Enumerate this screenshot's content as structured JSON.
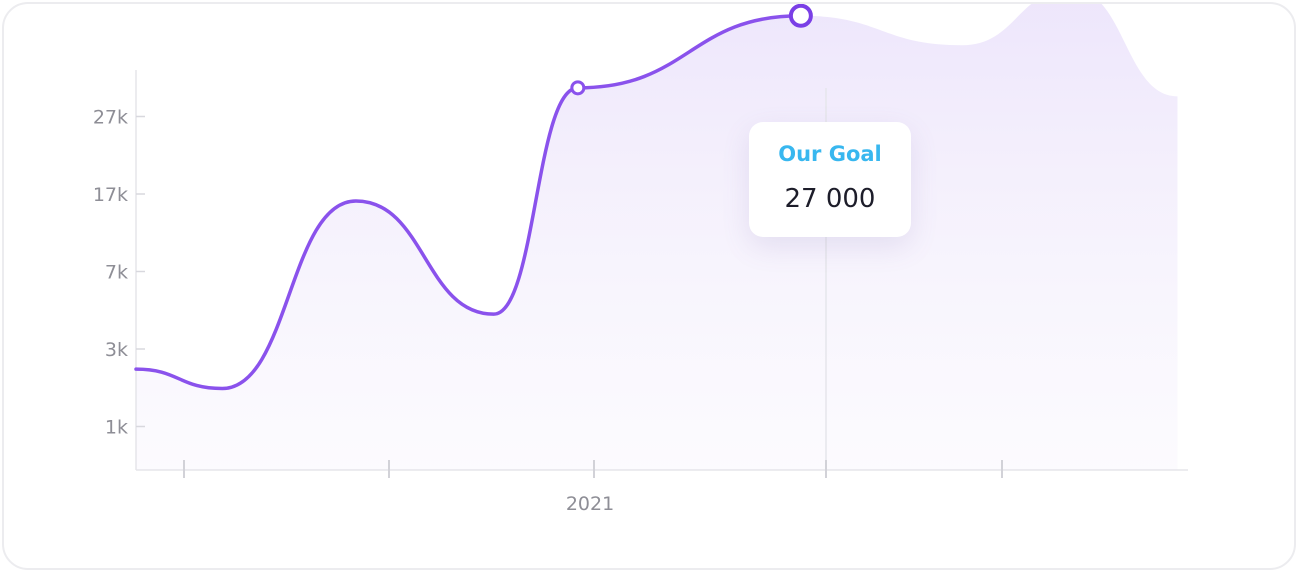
{
  "chart_data": {
    "type": "line",
    "title": "",
    "xlabel": "",
    "ylabel": "",
    "y_ticks": [
      "1k",
      "3k",
      "7k",
      "17k",
      "27k"
    ],
    "x_tick_labels": [
      "",
      "",
      "2021",
      "",
      ""
    ],
    "grid": false,
    "series": [
      {
        "color": "#8a52ec",
        "points": [
          {
            "x": 0.0,
            "y": 0.74
          },
          {
            "x": 0.82,
            "y": 0.49
          },
          {
            "x": 2.09,
            "y": 2.91
          },
          {
            "x": 3.4,
            "y": 1.45
          },
          {
            "x": 4.2,
            "y": 4.37
          },
          {
            "x": 6.32,
            "y": 5.3
          }
        ]
      }
    ],
    "highlight": {
      "x": 6.32,
      "y": 5.3,
      "label": "Our Goal",
      "value": "27 000"
    },
    "projection_points": [
      {
        "x": 6.32,
        "y": 5.3
      },
      {
        "x": 7.85,
        "y": 4.92
      },
      {
        "x": 8.9,
        "y": 5.64
      },
      {
        "x": 9.9,
        "y": 4.26
      }
    ],
    "secondary_marker": {
      "x": 4.2,
      "y": 4.37
    }
  },
  "colors": {
    "line": "#8a52ec",
    "fill": "#ece4fb",
    "tooltip_title": "#38b7ef",
    "axis": "#e5e5ea"
  }
}
